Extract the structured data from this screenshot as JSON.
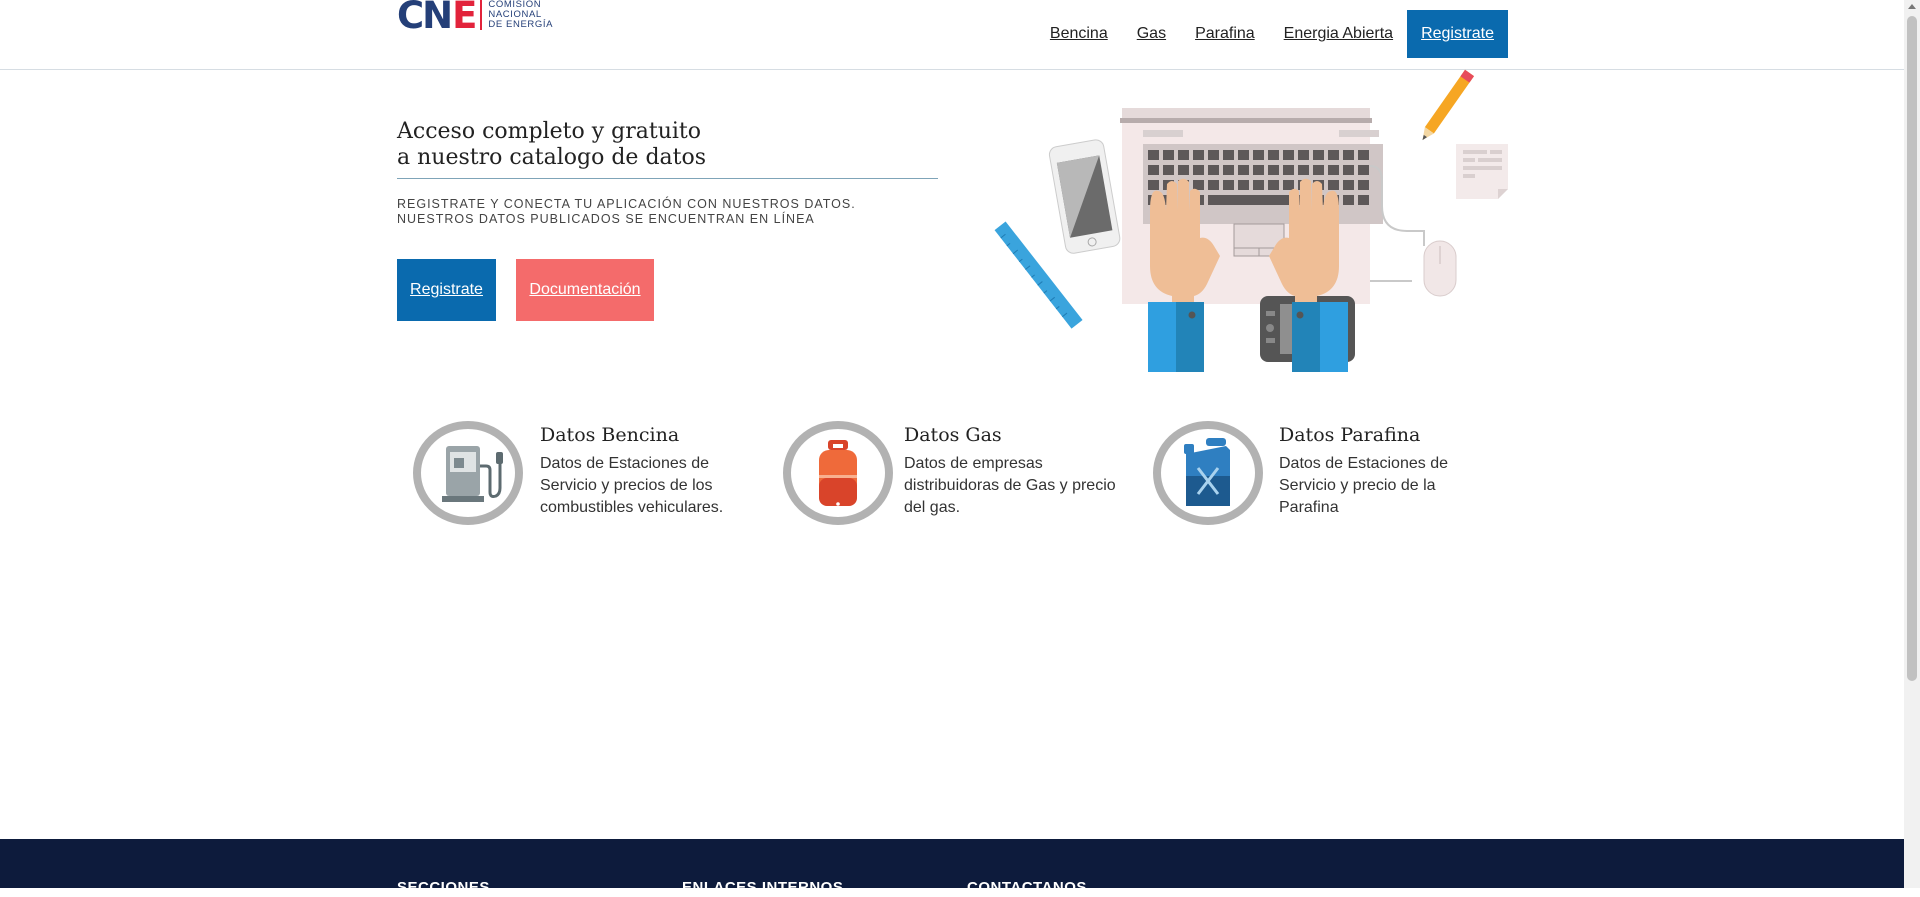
{
  "brand": {
    "logo_letters": "CN",
    "logo_letter_e": "E",
    "logo_line1": "COMISIÓN",
    "logo_line2": "NACIONAL",
    "logo_line3": "DE ENERGÍA",
    "color_blue": "#243f78",
    "color_red": "#e2233b"
  },
  "nav": {
    "items": [
      "Bencina",
      "Gas",
      "Parafina",
      "Energia Abierta"
    ],
    "cta": "Registrate"
  },
  "hero": {
    "title_line1": "Acceso completo y gratuito",
    "title_line2": "a nuestro catalogo de datos",
    "subtitle_line1": "REGISTRATE Y CONECTA TU APLICACIÓN CON NUESTROS DATOS.",
    "subtitle_line2": "NUESTROS DATOS PUBLICADOS SE ENCUENTRAN EN LÍNEA",
    "register_button": "Registrate",
    "docs_button": "Documentación"
  },
  "features": [
    {
      "title": "Datos Bencina",
      "description": "Datos de Estaciones de Servicio y precios de los combustibles vehiculares.",
      "icon": "fuel-pump-icon"
    },
    {
      "title": "Datos Gas",
      "description": "Datos de empresas distribuidoras de Gas y precio del gas.",
      "icon": "gas-cylinder-icon"
    },
    {
      "title": "Datos Parafina",
      "description": "Datos de Estaciones de Servicio y precio de la Parafina",
      "icon": "jerrycan-icon"
    }
  ],
  "footer": {
    "col1": "SECCIONES",
    "col2": "ENLACES INTERNOS",
    "col3": "CONTACTANOS"
  },
  "colors": {
    "primary": "#0a6aae",
    "secondary": "#f46b6b",
    "footer": "#0d1b3c"
  }
}
